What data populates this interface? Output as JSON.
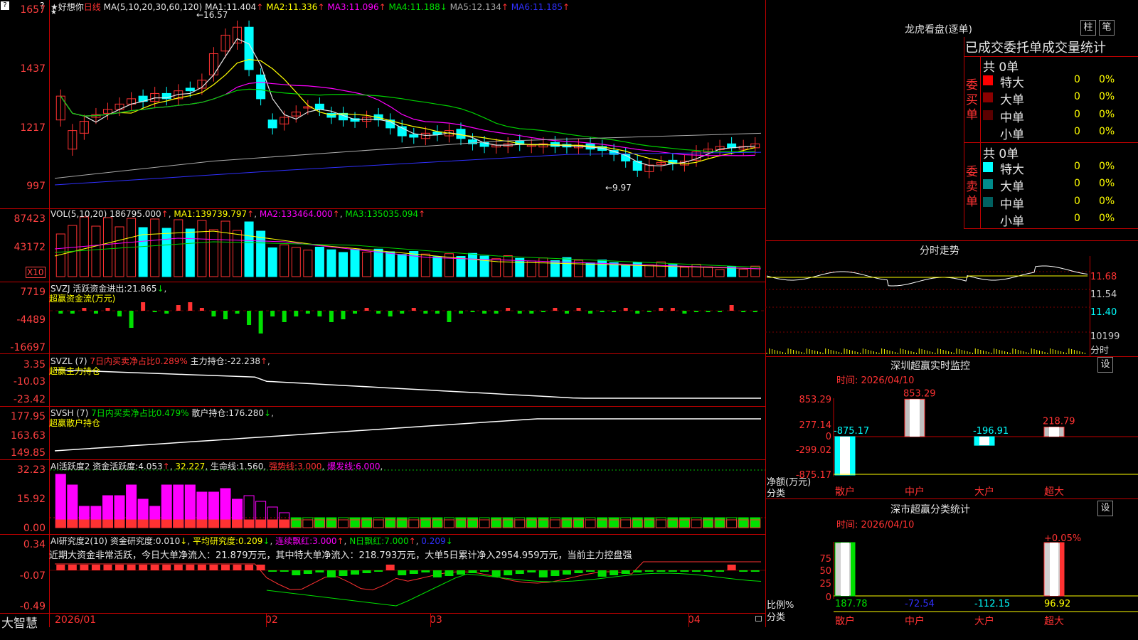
{
  "colors": {
    "up": "#ff3232",
    "down": "#00ffff",
    "ma1": "#e6e6e6",
    "ma2": "#ffff00",
    "ma3": "#ff00ff",
    "ma4": "#00d000",
    "ma5": "#aaaaaa",
    "ma6": "#3030ff",
    "grid": "#c00000",
    "green_bar": "#00e000",
    "magenta_bar": "#ff00ff"
  },
  "app_name": "大智慧",
  "menu_icon": "?",
  "main": {
    "title": "★好想你",
    "period": "日线",
    "ma_params": "MA(5,10,20,30,60,120)",
    "ma": [
      {
        "label": "MA1:",
        "value": "11.404",
        "arrow": "↑"
      },
      {
        "label": "MA2:",
        "value": "11.336",
        "arrow": "↑"
      },
      {
        "label": "MA3:",
        "value": "11.096",
        "arrow": "↑"
      },
      {
        "label": "MA4:",
        "value": "11.188",
        "arrow": "↓"
      },
      {
        "label": "MA5:",
        "value": "12.134",
        "arrow": "↑"
      },
      {
        "label": "MA6:",
        "value": "11.185",
        "arrow": "↑"
      }
    ],
    "y_axis": [
      "1657",
      "1437",
      "1217",
      "997"
    ],
    "high_marker": "←16.57",
    "low_marker": "←9.97",
    "star_marker": "★"
  },
  "vol": {
    "params": "VOL(5,10,20)",
    "value": "186795.000",
    "arrow": "↑",
    "ma": [
      {
        "label": "MA1:",
        "value": "139739.797",
        "arrow": "↑"
      },
      {
        "label": "MA2:",
        "value": "133464.000",
        "arrow": "↑"
      },
      {
        "label": "MA3:",
        "value": "135035.094",
        "arrow": "↑"
      }
    ],
    "y_axis": [
      "87423",
      "43172"
    ],
    "unit": "X10"
  },
  "svzj": {
    "name": "SVZJ",
    "label": "活跃资金进出:",
    "value": "21.865",
    "arrow": "↓",
    "subtitle": "超赢资金流(万元)",
    "y_axis": [
      "7719",
      "-4489",
      "-16697"
    ]
  },
  "svzl": {
    "name": "SVZL (7)",
    "label1": "7日内买卖净占比0.289%",
    "label2": "主力持仓:",
    "value": "-22.238",
    "arrow": "↑",
    "subtitle": "超赢主力持仓",
    "y_axis": [
      "3.35",
      "-10.03",
      "-23.42"
    ]
  },
  "svsh": {
    "name": "SVSH (7)",
    "label1": "7日内买卖净占比0.479%",
    "label2": "散户持仓:",
    "value": "176.280",
    "arrow": "↓",
    "subtitle": "超赢散户持仓",
    "y_axis": [
      "177.95",
      "163.63",
      "149.85"
    ]
  },
  "ai_active": {
    "name": "AI活跃度2",
    "label": "资金活跃度:",
    "value": "4.053",
    "arrow": "↑",
    "v2": "32.227",
    "life_label": "生命线:",
    "life": "1.560",
    "strong_label": "强势线:",
    "strong": "3.000",
    "burst_label": "爆发线:",
    "burst": "6.000",
    "y_axis": [
      "32.23",
      "15.92",
      "0.00"
    ]
  },
  "ai_research": {
    "name": "AI研究度2(10)",
    "label": "资金研究度:",
    "value": "0.010",
    "arrow": "↓",
    "avg_label": "平均研究度:",
    "avg": "0.209",
    "avg_arrow": "↓",
    "red_label": "连续飘红:",
    "red": "3.000",
    "red_arrow": "↑",
    "nred_label": "N日飘红:",
    "nred": "7.000",
    "nred_arrow": "↑",
    "last": "0.209",
    "last_arrow": "↓",
    "comment": "近期大资金非常活跃，今日大单净流入：21.879万元，其中特大单净流入：218.793万元，大单5日累计净入2954.959万元，当前主力控盘强",
    "y_axis": [
      "0.34",
      "-0.07",
      "-0.49"
    ]
  },
  "x_axis": [
    "2026/01",
    "02",
    "03",
    "04"
  ],
  "right": {
    "dragon_title": "龙虎看盘(逐单)",
    "btn1": "柱",
    "btn2": "笔",
    "tabs": "已成交委托单成交量统计",
    "buy_side": "委买单",
    "sell_side": "委卖单",
    "buy_total": "共 0单",
    "sell_total": "共 0单",
    "buy_rows": [
      {
        "label": "特大",
        "count": "0",
        "pct": "0%",
        "color": "#ff0000"
      },
      {
        "label": "大单",
        "count": "0",
        "pct": "0%",
        "color": "#8b0000"
      },
      {
        "label": "中单",
        "count": "0",
        "pct": "0%",
        "color": "#5a0000"
      },
      {
        "label": "小单",
        "count": "0",
        "pct": "0%",
        "color": ""
      }
    ],
    "sell_rows": [
      {
        "label": "特大",
        "count": "0",
        "pct": "0%",
        "color": "#00ffff"
      },
      {
        "label": "大单",
        "count": "0",
        "pct": "0%",
        "color": "#008b8b"
      },
      {
        "label": "中单",
        "count": "0",
        "pct": "0%",
        "color": "#006060"
      },
      {
        "label": "小单",
        "count": "0",
        "pct": "0%",
        "color": ""
      }
    ],
    "intraday_title": "分时走势",
    "intraday_y": [
      "11.68",
      "11.54",
      "11.40",
      "10199"
    ],
    "intraday_unit": "分时",
    "monitor_title": "深圳超赢实时监控",
    "monitor_btn": "设",
    "monitor_time": "时间: 2026/04/10",
    "monitor_y": [
      "853.29",
      "277.14",
      "0",
      "-299.02",
      "-875.17"
    ],
    "monitor_values": [
      {
        "cat": "散户",
        "value": -875.17,
        "label": "-875.17"
      },
      {
        "cat": "中户",
        "value": 853.29,
        "label": "853.29"
      },
      {
        "cat": "大户",
        "value": -196.91,
        "label": "-196.91"
      },
      {
        "cat": "超大",
        "value": 218.79,
        "label": "218.79"
      }
    ],
    "monitor_ylabel": "净额(万元)",
    "monitor_xlabel": "分类",
    "class_title": "深市超赢分类统计",
    "class_btn": "设",
    "class_time": "时间: 2026/04/10",
    "class_y": [
      "75",
      "50",
      "25",
      "0"
    ],
    "class_top": "+0.05%",
    "class_values": [
      {
        "cat": "散户",
        "label": "187.78"
      },
      {
        "cat": "中户",
        "label": "-72.54"
      },
      {
        "cat": "大户",
        "label": "-112.15"
      },
      {
        "cat": "超大",
        "label": "96.92"
      }
    ],
    "class_ylabel": "比例%",
    "class_xlabel": "分类"
  }
}
